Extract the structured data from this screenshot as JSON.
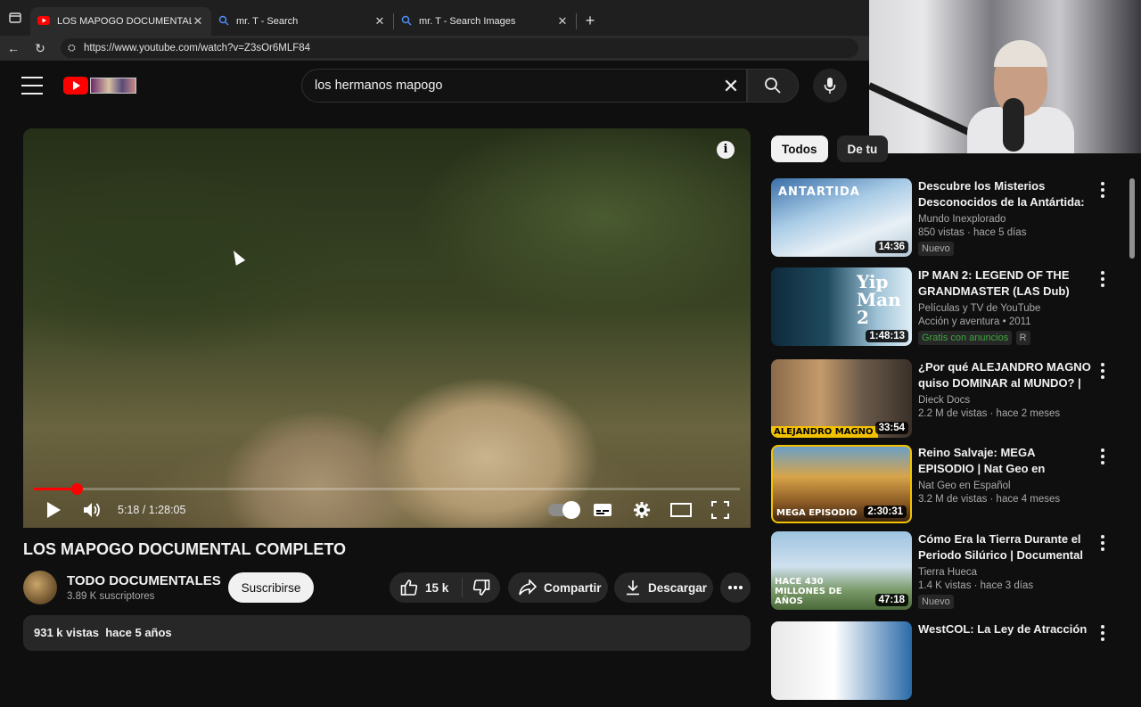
{
  "browser": {
    "tabs": [
      {
        "title": "LOS MAPOGO DOCUMENTAL CO",
        "active": true,
        "icon": "youtube-icon"
      },
      {
        "title": "mr. T - Search",
        "active": false,
        "icon": "search-icon"
      },
      {
        "title": "mr. T - Search Images",
        "active": false,
        "icon": "search-icon"
      }
    ],
    "url": "https://www.youtube.com/watch?v=Z3sOr6MLF84"
  },
  "header": {
    "search_value": "los hermanos mapogo"
  },
  "player": {
    "time": "5:18 / 1:28:05",
    "progress_fraction": 0.06,
    "accent": "#ff0000"
  },
  "video": {
    "title": "LOS MAPOGO DOCUMENTAL COMPLETO",
    "channel": "TODO DOCUMENTALES",
    "subscribers": "3.89 K suscriptores",
    "subscribe_label": "Suscribirse",
    "likes": "15 k",
    "share_label": "Compartir",
    "download_label": "Descargar",
    "description_stats": "931 k vistas  hace 5 años"
  },
  "chips": [
    "Todos",
    "De tu"
  ],
  "recommendations": [
    {
      "title": "Descubre los Misterios Desconocidos de la Antártida: ...",
      "channel": "Mundo Inexplorado",
      "stats": "850 vistas · hace 5 días",
      "badge": "Nuevo",
      "duration": "14:36",
      "thumb_text": "ANTARTIDA"
    },
    {
      "title": "IP MAN 2: LEGEND OF THE GRANDMASTER (LAS Dub)",
      "channel": "Películas y TV de YouTube",
      "stats": "Acción y aventura • 2011",
      "badge": "Gratis con anuncios",
      "badge2": "R",
      "duration": "1:48:13",
      "thumb_text": "Yip Man 2"
    },
    {
      "title": "¿Por qué ALEJANDRO MAGNO quiso DOMINAR al MUNDO? | ...",
      "channel": "Dieck Docs",
      "stats": "2.2 M de vistas · hace 2 meses",
      "badge": "",
      "duration": "33:54",
      "thumb_text": "ALEJANDRO MAGNO"
    },
    {
      "title": "Reino Salvaje: MEGA EPISODIO | Nat Geo en Español",
      "channel": "Nat Geo en Español",
      "stats": "3.2 M de vistas · hace 4 meses",
      "badge": "",
      "duration": "2:30:31",
      "thumb_text": "MEGA EPISODIO"
    },
    {
      "title": "Cómo Era la Tierra Durante el Periodo Silúrico | Documental ...",
      "channel": "Tierra Hueca",
      "stats": "1.4 K vistas · hace 3 días",
      "badge": "Nuevo",
      "duration": "47:18",
      "thumb_text": "HACE 430 MILLONES DE AÑOS"
    },
    {
      "title": "WestCOL: La Ley de Atracción",
      "channel": "",
      "stats": "",
      "badge": "",
      "duration": "",
      "thumb_text": ""
    }
  ]
}
